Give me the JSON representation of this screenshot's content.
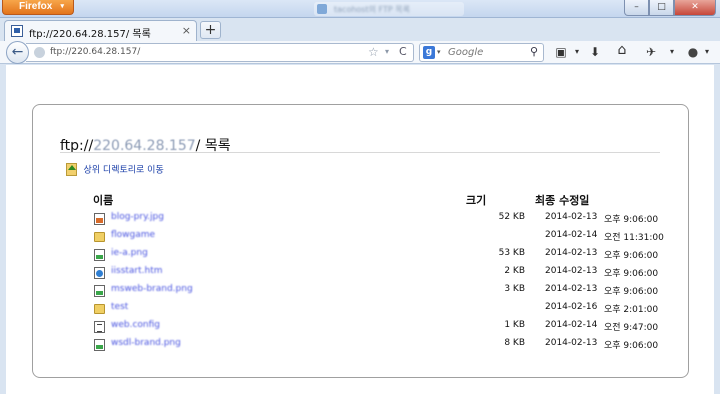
{
  "titlebar": {
    "app_button": "Firefox",
    "background_window_title": "tacohost의 FTP 목록",
    "min": "–",
    "max": "□",
    "close": "✕"
  },
  "tab": {
    "label": "ftp://220.64.28.157/ 목록",
    "close": "×",
    "new_tab": "+"
  },
  "navbar": {
    "url": "ftp://220.64.28.157/",
    "search_placeholder": "Google",
    "search_engine_letter": "g",
    "dropdown_arrow": "▾",
    "star": "☆",
    "reload": "C",
    "magnifier": "⚲",
    "downloads": "⬇",
    "home": "⌂",
    "screenshot": "▣",
    "addon": "✈",
    "addon2": "●"
  },
  "listing": {
    "heading_prefix": "ftp://",
    "heading_host": "220.64.28.157",
    "heading_suffix": "/ 목록",
    "up_link": "상위 디렉토리로 이동",
    "col_name": "이름",
    "col_size": "크기",
    "col_date": "최종 수정일",
    "rows": [
      {
        "name": "blog-pry.jpg",
        "type": "jpg",
        "size": "52 KB",
        "date": "2014-02-13",
        "time": "오후 9:06:00"
      },
      {
        "name": "flowgame",
        "type": "folder",
        "size": "",
        "date": "2014-02-14",
        "time": "오전 11:31:00"
      },
      {
        "name": "ie-a.png",
        "type": "image",
        "size": "53 KB",
        "date": "2014-02-13",
        "time": "오후 9:06:00"
      },
      {
        "name": "iisstart.htm",
        "type": "html",
        "size": "2 KB",
        "date": "2014-02-13",
        "time": "오후 9:06:00"
      },
      {
        "name": "msweb-brand.png",
        "type": "image",
        "size": "3 KB",
        "date": "2014-02-13",
        "time": "오후 9:06:00"
      },
      {
        "name": "test",
        "type": "folder",
        "size": "",
        "date": "2014-02-16",
        "time": "오후 2:01:00"
      },
      {
        "name": "web.config",
        "type": "text",
        "size": "1 KB",
        "date": "2014-02-14",
        "time": "오전 9:47:00"
      },
      {
        "name": "wsdl-brand.png",
        "type": "image",
        "size": "8 KB",
        "date": "2014-02-13",
        "time": "오후 9:06:00"
      }
    ]
  }
}
